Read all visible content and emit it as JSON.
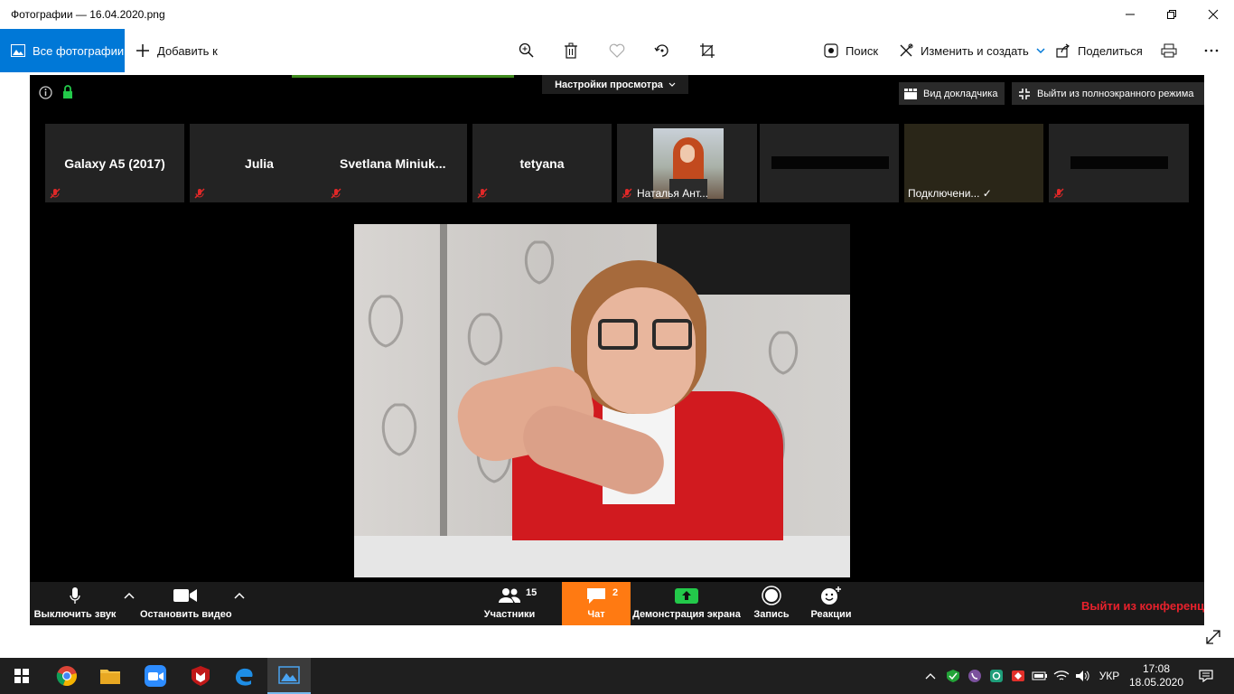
{
  "window": {
    "title": "Фотографии — 16.04.2020.png"
  },
  "toolbar": {
    "all_photos": "Все фотографии",
    "add_to": "Добавить к",
    "search": "Поиск",
    "edit_create": "Изменить и создать",
    "share": "Поделиться"
  },
  "zoom": {
    "view_settings": "Настройки просмотра",
    "speaker_view": "Вид докладчика",
    "exit_fullscreen": "Выйти из полноэкранного режима",
    "participants": [
      {
        "name": "Galaxy A5 (2017)"
      },
      {
        "name": "Julia"
      },
      {
        "name": "Svetlana  Miniuk..."
      },
      {
        "name": "tetyana"
      },
      {
        "label": "Наталья Ант..."
      },
      {
        "label": ""
      },
      {
        "label": "Подключени... ✓"
      },
      {
        "label": ""
      }
    ],
    "controls": {
      "mute": "Выключить звук",
      "stop_video": "Остановить видео",
      "participants": "Участники",
      "participants_count": "15",
      "chat": "Чат",
      "chat_count": "2",
      "share_screen": "Демонстрация экрана",
      "record": "Запись",
      "reactions": "Реакции",
      "leave": "Выйти из конференции"
    }
  },
  "taskbar": {
    "language": "УКР",
    "time": "17:08",
    "date": "18.05.2020"
  }
}
